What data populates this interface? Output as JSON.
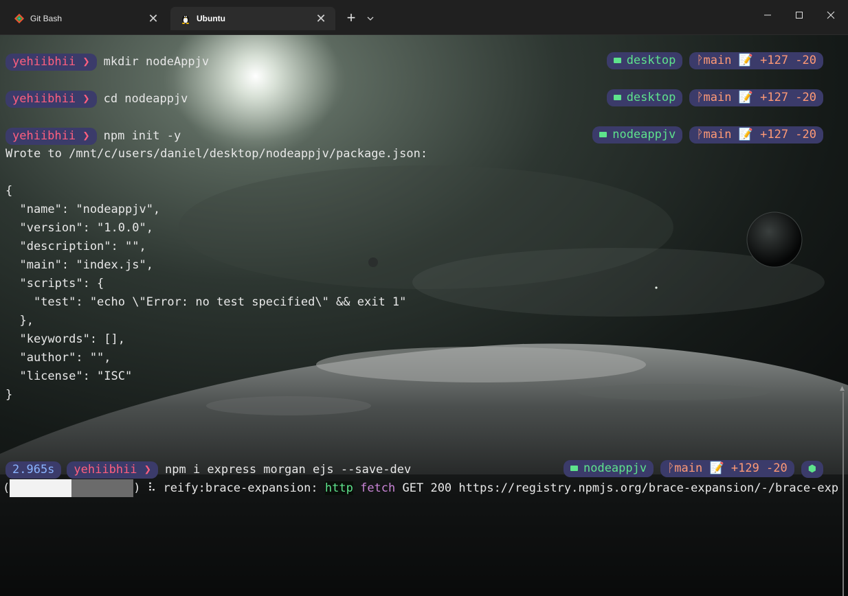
{
  "tabs": [
    {
      "label": "Git Bash",
      "icon": "git-bash-icon"
    },
    {
      "label": "Ubuntu",
      "icon": "tux-linux-icon"
    }
  ],
  "newtab_label": "+",
  "prompt": {
    "user": "yehiibhii ❯",
    "elapsed": "2.965s"
  },
  "commands": {
    "cmd1": "mkdir nodeAppjv",
    "cmd2": "cd nodeappjv",
    "cmd3": "npm init -y",
    "cmd4": "npm i express morgan ejs --save-dev"
  },
  "right_prompts": [
    {
      "dir": "desktop",
      "git": "ᚹmain 📝 +127 -20"
    },
    {
      "dir": "desktop",
      "git": "ᚹmain 📝 +127 -20"
    },
    {
      "dir": "nodeappjv",
      "git": "ᚹmain 📝 +127 -20"
    },
    {
      "dir": "nodeappjv",
      "git": "ᚹmain 📝 +129 -20",
      "extra": "⬢"
    }
  ],
  "output": {
    "wrote": "Wrote to /mnt/c/users/daniel/desktop/nodeappjv/package.json:",
    "json_lines": [
      "{",
      "  \"name\": \"nodeappjv\",",
      "  \"version\": \"1.0.0\",",
      "  \"description\": \"\",",
      "  \"main\": \"index.js\",",
      "  \"scripts\": {",
      "    \"test\": \"echo \\\"Error: no test specified\\\" && exit 1\"",
      "  },",
      "  \"keywords\": [],",
      "  \"author\": \"\",",
      "  \"license\": \"ISC\"",
      "}"
    ]
  },
  "progress": {
    "open": "(",
    "close": ")",
    "spinner": "⠧",
    "text": "reify:brace-expansion:",
    "http": "http",
    "fetch": "fetch",
    "rest": "GET 200 https://registry.npmjs.org/brace-expansion/-/brace-exp",
    "fraction": 0.5
  },
  "colors": {
    "user": "#ff5f7f",
    "dir": "#5ee38c",
    "git": "#ff9a76",
    "pill_bg": "#3b3b6a",
    "fetch": "#c984d6"
  }
}
